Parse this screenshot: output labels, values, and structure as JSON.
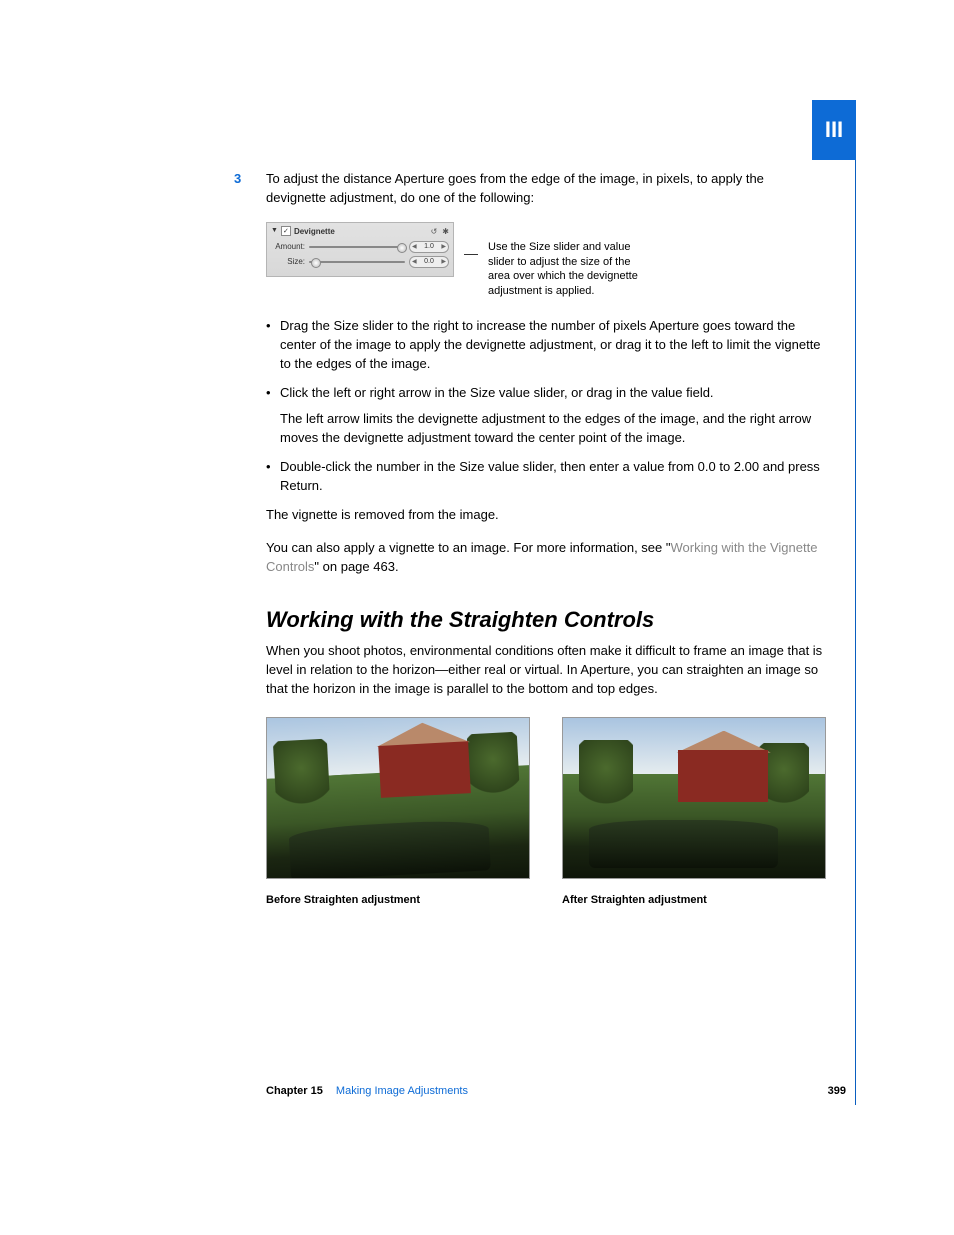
{
  "part_label": "III",
  "step": {
    "number": "3",
    "text": "To adjust the distance Aperture goes from the edge of the image, in pixels, to apply the devignette adjustment, do one of the following:"
  },
  "panel": {
    "title": "Devignette",
    "checkbox_checked": "✓",
    "reset_glyph": "↺",
    "gear_glyph": "✱",
    "rows": {
      "amount": {
        "label": "Amount:",
        "value": "1.0",
        "knob_pos": "92%"
      },
      "size": {
        "label": "Size:",
        "value": "0.0",
        "knob_pos": "2%"
      }
    }
  },
  "callout": "Use the Size slider and value slider to adjust the size of the area over which the devignette adjustment is applied.",
  "bullets": [
    "Drag the Size slider to the right to increase the number of pixels Aperture goes toward the center of the image to apply the devignette adjustment, or drag it to the left to limit the vignette to the edges of the image.",
    "Click the left or right arrow in the Size value slider, or drag in the value field.",
    "Double-click the number in the Size value slider, then enter a value from 0.0 to 2.00 and press Return."
  ],
  "bullet2_follow": "The left arrow limits the devignette adjustment to the edges of the image, and the right arrow moves the devignette adjustment toward the center point of the image.",
  "after_bullets": "The vignette is removed from the image.",
  "more_info": {
    "pre": "You can also apply a vignette to an image. For more information, see \"",
    "link": "Working with the Vignette Controls",
    "post": "\" on page 463."
  },
  "section": {
    "heading": "Working with the Straighten Controls",
    "body": "When you shoot photos, environmental conditions often make it difficult to frame an image that is level in relation to the horizon—either real or virtual. In Aperture, you can straighten an image so that the horizon in the image is parallel to the bottom and top edges."
  },
  "images": {
    "before_caption": "Before Straighten adjustment",
    "after_caption": "After Straighten adjustment"
  },
  "footer": {
    "chapter": "Chapter 15",
    "title": "Making Image Adjustments",
    "page": "399"
  }
}
